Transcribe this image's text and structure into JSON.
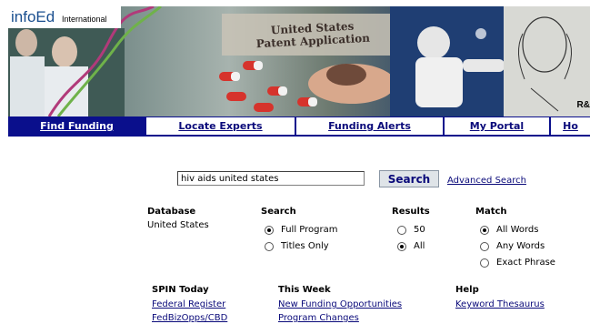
{
  "brand": {
    "logo": "infoEd",
    "logo_sub": "International"
  },
  "banner": {
    "patent_title_line1": "United States",
    "patent_title_line2": "Patent Application",
    "corner_text": "R&"
  },
  "nav": {
    "tabs": [
      {
        "label": "Find Funding",
        "active": true
      },
      {
        "label": "Locate Experts",
        "active": false
      },
      {
        "label": "Funding Alerts",
        "active": false
      },
      {
        "label": "My Portal",
        "active": false
      },
      {
        "label": "Ho",
        "active": false
      }
    ]
  },
  "search": {
    "value": "hiv aids united states",
    "button": "Search",
    "advanced": "Advanced Search"
  },
  "options": {
    "database": {
      "heading": "Database",
      "value": "United States"
    },
    "search": {
      "heading": "Search",
      "choices": [
        {
          "label": "Full Program",
          "checked": true
        },
        {
          "label": "Titles Only",
          "checked": false
        }
      ]
    },
    "results": {
      "heading": "Results",
      "choices": [
        {
          "label": "50",
          "checked": false
        },
        {
          "label": "All",
          "checked": true
        }
      ]
    },
    "match": {
      "heading": "Match",
      "choices": [
        {
          "label": "All Words",
          "checked": true
        },
        {
          "label": "Any Words",
          "checked": false
        },
        {
          "label": "Exact Phrase",
          "checked": false
        }
      ]
    }
  },
  "links": {
    "spin_today": {
      "heading": "SPIN Today",
      "items": [
        "Federal Register",
        "FedBizOpps/CBD"
      ]
    },
    "this_week": {
      "heading": "This Week",
      "items": [
        "New Funding Opportunities",
        "Program Changes"
      ]
    },
    "help": {
      "heading": "Help",
      "items": [
        "Keyword Thesaurus"
      ]
    }
  },
  "colors": {
    "nav_bg": "#0a0f8c",
    "link": "#0a0a7a",
    "logo": "#1a4f8f"
  }
}
